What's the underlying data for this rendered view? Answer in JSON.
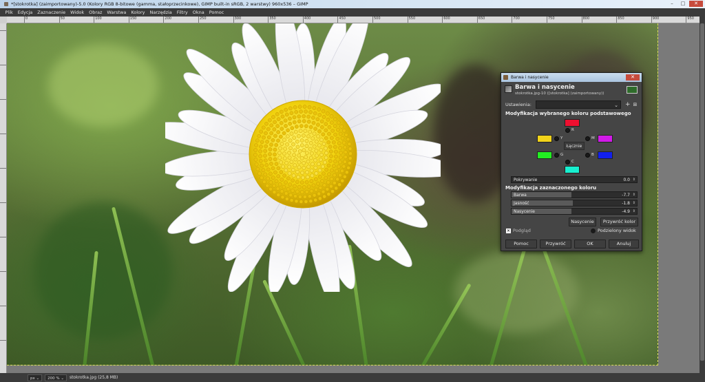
{
  "window": {
    "title": "*[stokrotka] (zaimportowany)-5.0 (Kolory RGB 8-bitowe (gamma, stałoprzecinkowe), GIMP built-in sRGB, 2 warstwy) 960x536 – GIMP",
    "controls": [
      "–",
      "□",
      "✕"
    ]
  },
  "menu": [
    "Plik",
    "Edycja",
    "Zaznaczenie",
    "Widok",
    "Obraz",
    "Warstwa",
    "Kolory",
    "Narzędzia",
    "Filtry",
    "Okna",
    "Pomoc"
  ],
  "ruler": {
    "top_labels": [
      "0",
      "50",
      "100",
      "150",
      "200",
      "250",
      "300",
      "350",
      "400",
      "450",
      "500",
      "550",
      "600",
      "650",
      "700",
      "750",
      "800",
      "850",
      "900",
      "950"
    ]
  },
  "status": {
    "unit": "px",
    "zoom": "200 %",
    "file_info": "stokrotka.jpg (25,8 MB)"
  },
  "dialog": {
    "window_title": "Barwa i nasycenie",
    "close": "✕",
    "header_title": "Barwa i nasycenie",
    "header_sub": "stokrotka.jpg-10 ([stokrotka] (zaimportowany))",
    "settings_label": "Ustawienia:",
    "section1": "Modyfikacja wybranego koloru podstawowego",
    "primaries": {
      "R": {
        "label": "R",
        "color": "#ee1030"
      },
      "Y": {
        "label": "Y",
        "color": "#f2d31a"
      },
      "G": {
        "label": "G",
        "color": "#22ee22"
      },
      "C": {
        "label": "C",
        "color": "#18efcf"
      },
      "B": {
        "label": "B",
        "color": "#1220ee"
      },
      "M": {
        "label": "M",
        "color": "#d21ae8"
      }
    },
    "center_button": "Łącznie",
    "overlap": {
      "label": "Pokrywanie",
      "value": "0.0",
      "fraction": 0.0
    },
    "section2": "Modyfikacja zaznaczonego koloru",
    "hue": {
      "label": "Barwa",
      "value": "-7.7",
      "fraction": 0.48
    },
    "lightness": {
      "label": "Jasność",
      "value": "-1.8",
      "fraction": 0.49
    },
    "saturation": {
      "label": "Nasycenie",
      "value": "-4.9",
      "fraction": 0.48
    },
    "reset_color_btn": "Przywróć kolor",
    "saturation_btn": "Nasycenie",
    "preview_label": "Podgląd",
    "split_label": "Podzielony widok",
    "buttons": {
      "help": "Pomoc",
      "reset": "Przywróć",
      "ok": "OK",
      "cancel": "Anuluj"
    }
  }
}
